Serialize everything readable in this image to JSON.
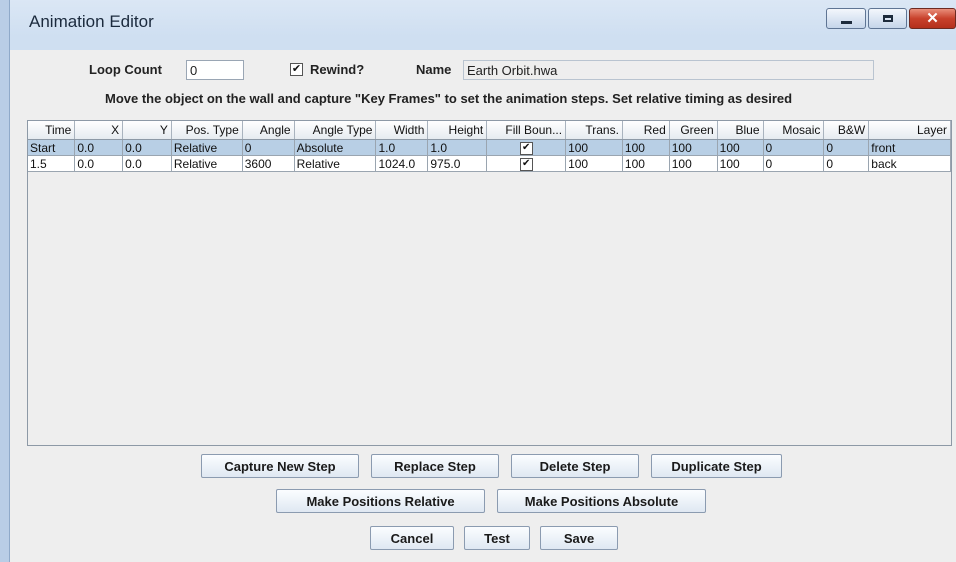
{
  "window": {
    "title": "Animation Editor"
  },
  "form": {
    "loop_count_label": "Loop Count",
    "loop_count_value": "0",
    "rewind_label": "Rewind?",
    "rewind_checked": true,
    "name_label": "Name",
    "name_value": "Earth Orbit.hwa",
    "instructions": "Move the object on the wall and capture \"Key Frames\" to set the animation steps. Set relative timing as desired"
  },
  "table": {
    "columns": [
      "Time",
      "X",
      "Y",
      "Pos. Type",
      "Angle",
      "Angle Type",
      "Width",
      "Height",
      "Fill Boun...",
      "Trans.",
      "Red",
      "Green",
      "Blue",
      "Mosaic",
      "B&W",
      "Layer"
    ],
    "rows": [
      [
        "Start",
        "0.0",
        "0.0",
        "Relative",
        "0",
        "Absolute",
        "1.0",
        "1.0",
        "✔",
        "100",
        "100",
        "100",
        "100",
        "0",
        "0",
        "front"
      ],
      [
        "1.5",
        "0.0",
        "0.0",
        "Relative",
        "3600",
        "Relative",
        "1024.0",
        "975.0",
        "✔",
        "100",
        "100",
        "100",
        "100",
        "0",
        "0",
        "back"
      ]
    ],
    "selected_row": 0
  },
  "buttons": {
    "capture_new_step": "Capture New Step",
    "replace_step": "Replace Step",
    "delete_step": "Delete Step",
    "duplicate_step": "Duplicate Step",
    "make_positions_relative": "Make Positions Relative",
    "make_positions_absolute": "Make Positions Absolute",
    "cancel": "Cancel",
    "test": "Test",
    "save": "Save"
  },
  "icons": {
    "minimize": "minimize-icon",
    "maximize": "maximize-icon",
    "close": "close-icon"
  }
}
